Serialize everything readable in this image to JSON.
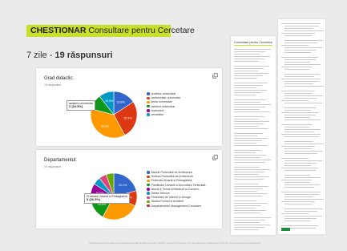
{
  "header": {
    "brand": "CHESTIONAR",
    "title": " Consultare pentru Cercetare"
  },
  "summary": {
    "days": "7 zile - ",
    "responses": "19 răspunsuri"
  },
  "colors": {
    "banner": "#c8e02a"
  },
  "q1": {
    "title": "Grad didactic:",
    "sub": "19 răspunsuri",
    "tooltip_label": "asistent universitar",
    "tooltip_value": "2 (10.5%)",
    "options": [
      {
        "label": "profesor universitar",
        "color": "#3366cc"
      },
      {
        "label": "conferențiar universitar",
        "color": "#dc3912"
      },
      {
        "label": "lector universitar",
        "color": "#ff9900"
      },
      {
        "label": "asistent universitar",
        "color": "#109618"
      },
      {
        "label": "doctorand",
        "color": "#990099"
      },
      {
        "label": "cercetător",
        "color": "#0099c6"
      }
    ]
  },
  "q2": {
    "title": "Departamentul:",
    "sub": "19 răspunsuri",
    "tooltip_label": "Protecția Urbană și Peisagistică",
    "tooltip_value": "5 (26.3%)",
    "options": [
      {
        "label": "Bazele Proiectării de Arhitectură",
        "color": "#3366cc"
      },
      {
        "label": "Sinteza Proiectării de Arhitectură",
        "color": "#dc3912"
      },
      {
        "label": "Protecția Urbană și Peisagistică",
        "color": "#ff9900"
      },
      {
        "label": "Planificare Urbană și Dezvoltare Teritorială",
        "color": "#109618"
      },
      {
        "label": "Istoria & Teoria Arhitecturii și Conserv...",
        "color": "#990099"
      },
      {
        "label": "Științe Tehnice",
        "color": "#0099c6"
      },
      {
        "label": "Proiectare de Interior și Design",
        "color": "#dd4477"
      },
      {
        "label": "Studiul Formei și Ambient",
        "color": "#66aa00"
      },
      {
        "label": "Departamentul Management Cercetare",
        "color": "#b82e2e"
      }
    ]
  },
  "chart_data": [
    {
      "type": "pie",
      "title": "Grad didactic:",
      "categories": [
        "profesor universitar",
        "conferențiar universitar",
        "lector universitar",
        "asistent universitar",
        "doctorand",
        "cercetător"
      ],
      "values": [
        15.8,
        26.3,
        36.8,
        10.5,
        0,
        10.5
      ],
      "labels": [
        "15.8%",
        "26.3%",
        "36.8%",
        "",
        "",
        "10.5%"
      ]
    },
    {
      "type": "pie",
      "title": "Departamentul:",
      "categories": [
        "Bazele Proiectării de Arhitectură",
        "Sinteza Proiectării de Arhitectură",
        "Protecția Urbană și Peisagistică",
        "Planificare Urbană și Dezvoltare Teritorială",
        "Istoria & Teoria Arhitecturii și Conserv...",
        "Științe Tehnice",
        "Proiectare de Interior și Design",
        "Studiul Formei și Ambient",
        "Departamentul Management Cercetare"
      ],
      "values": [
        21.1,
        10.5,
        26.3,
        15.8,
        10.5,
        5.3,
        5.3,
        5.3,
        0
      ],
      "labels": [
        "21.1%",
        "10.5%",
        "",
        "15.8%",
        "10.5%",
        "",
        "",
        "",
        ""
      ]
    }
  ],
  "doc1": {
    "title": "Consultare pentru Cercetare"
  },
  "footer": {
    "text": "\"Obiectivele pentru stimularea și gestionarea activității științifice și inovării (UAUIM): inclusiv în chestionare, Nu tratați datele din chestionare în niciun fel, pentru scopuri/comerciale/interes\""
  }
}
